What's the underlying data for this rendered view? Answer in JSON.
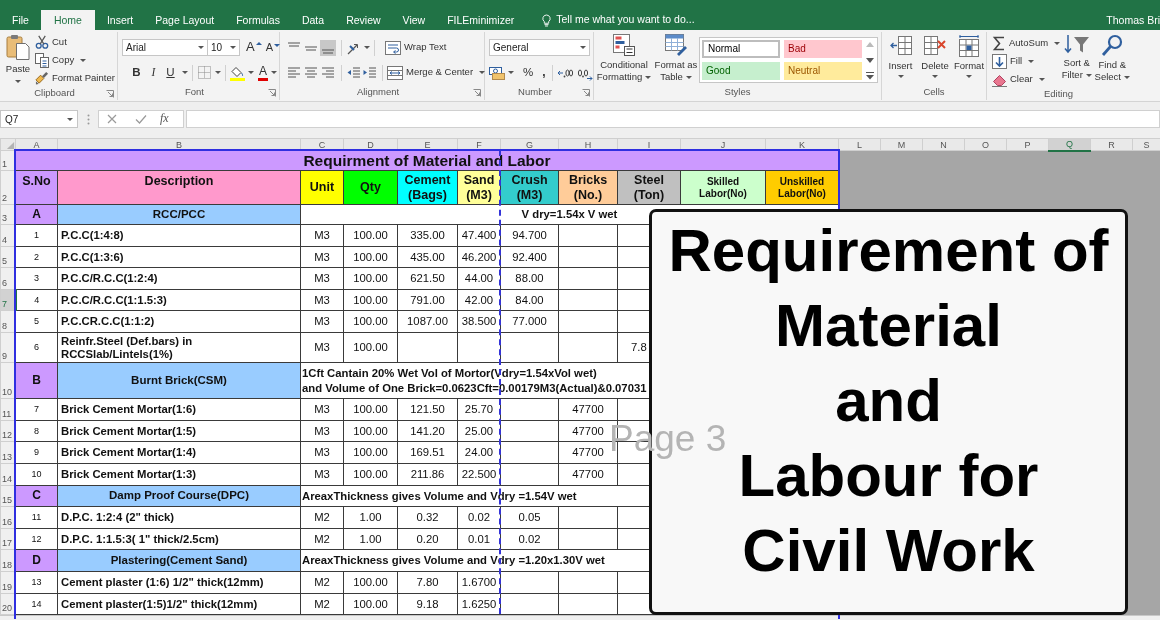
{
  "app": {
    "tell_me": "Tell me what you want to do...",
    "user_name": "Thomas Bri"
  },
  "ribbon_tabs": [
    {
      "label": "File",
      "selected": false
    },
    {
      "label": "Home",
      "selected": true
    },
    {
      "label": "Insert",
      "selected": false
    },
    {
      "label": "Page Layout",
      "selected": false
    },
    {
      "label": "Formulas",
      "selected": false
    },
    {
      "label": "Data",
      "selected": false
    },
    {
      "label": "Review",
      "selected": false
    },
    {
      "label": "View",
      "selected": false
    },
    {
      "label": "FILEminimizer",
      "selected": false
    }
  ],
  "ribbon": {
    "clipboard": {
      "label": "Clipboard",
      "paste": "Paste",
      "cut": "Cut",
      "copy": "Copy",
      "format_painter": "Format Painter"
    },
    "font": {
      "label": "Font",
      "font_name": "Arial",
      "font_size": "10",
      "grow": "A",
      "shrink": "A",
      "bold": "B",
      "italic": "I",
      "underline": "U",
      "font_color": "A"
    },
    "alignment": {
      "label": "Alignment",
      "vertical": [
        {
          "kind": "top",
          "selected": false
        },
        {
          "kind": "middle",
          "selected": false
        },
        {
          "kind": "bottom",
          "selected": true
        }
      ],
      "wrap_text": "Wrap Text",
      "merge_center": "Merge & Center"
    },
    "number": {
      "label": "Number",
      "format": "General",
      "percent": "%",
      "comma": ","
    },
    "styles": {
      "label": "Styles",
      "conditional_formatting": "Conditional Formatting",
      "format_as_table": "Format as Table",
      "gallery": [
        {
          "label": "Normal",
          "kind": "normal"
        },
        {
          "label": "Bad",
          "kind": "bad"
        },
        {
          "label": "Good",
          "kind": "good"
        },
        {
          "label": "Neutral",
          "kind": "neutral"
        }
      ]
    },
    "cells": {
      "label": "Cells",
      "buttons": [
        {
          "label": "Insert",
          "kind": "insert"
        },
        {
          "label": "Delete",
          "kind": "delete"
        },
        {
          "label": "Format",
          "kind": "format"
        }
      ]
    },
    "editing": {
      "label": "Editing",
      "autosum": "AutoSum",
      "fill": "Fill",
      "clear": "Clear",
      "sort_filter": "Sort & Filter",
      "find_select": "Find & Select"
    }
  },
  "formula_bar": {
    "name_box": "Q7",
    "function_button": "fx"
  },
  "sheet": {
    "columns": [
      {
        "label": "A",
        "selected": false
      },
      {
        "label": "B",
        "selected": false
      },
      {
        "label": "C",
        "selected": false
      },
      {
        "label": "D",
        "selected": false
      },
      {
        "label": "E",
        "selected": false
      },
      {
        "label": "F",
        "selected": false
      },
      {
        "label": "G",
        "selected": false
      },
      {
        "label": "H",
        "selected": false
      },
      {
        "label": "I",
        "selected": false
      },
      {
        "label": "J",
        "selected": false
      },
      {
        "label": "K",
        "selected": false
      },
      {
        "label": "L",
        "selected": false
      },
      {
        "label": "M",
        "selected": false
      },
      {
        "label": "N",
        "selected": false
      },
      {
        "label": "O",
        "selected": false
      },
      {
        "label": "P",
        "selected": false
      },
      {
        "label": "Q",
        "selected": true
      },
      {
        "label": "R",
        "selected": false
      },
      {
        "label": "S",
        "selected": false
      }
    ],
    "rows": [
      {
        "number": "1",
        "selected": false,
        "kind": "title",
        "text": "Requirment of Material and Labor"
      },
      {
        "number": "2",
        "selected": false,
        "kind": "header",
        "cells": [
          {
            "text": "S.No",
            "color": "#cc99ff"
          },
          {
            "text": "Description",
            "color": "#ff99cc"
          },
          {
            "text": "Unit",
            "color": "#ffff00"
          },
          {
            "text": "Qty",
            "color": "#00ff00"
          },
          {
            "text": "Cement (Bags)",
            "color": "#00ffff"
          },
          {
            "text": "Sand (M3)",
            "color": "#ffff99"
          },
          {
            "text": "Crush (M3)",
            "color": "#33cccc"
          },
          {
            "text": "Bricks (No.)",
            "color": "#ffcc99"
          },
          {
            "text": "Steel (Ton)",
            "color": "#c0c0c0"
          },
          {
            "text": "Skilled Labor(No)",
            "color": "#ccffcc"
          },
          {
            "text": "Unskilled Labor(No)",
            "color": "#ffcc00"
          }
        ]
      },
      {
        "number": "3",
        "selected": false,
        "kind": "section",
        "code": "A",
        "title": "RCC/PCC",
        "note": {
          "kind": "centered",
          "text": "V dry=1.54x V wet"
        }
      },
      {
        "number": "4",
        "selected": false,
        "kind": "item",
        "sno": "1",
        "description": "P.C.C(1:4:8)",
        "unit": "M3",
        "qty": "100.00",
        "cement": "335.00",
        "sand": "47.400",
        "crush": "94.700"
      },
      {
        "number": "5",
        "selected": false,
        "kind": "item",
        "sno": "2",
        "description": "P.C.C(1:3:6)",
        "unit": "M3",
        "qty": "100.00",
        "cement": "435.00",
        "sand": "46.200",
        "crush": "92.400"
      },
      {
        "number": "6",
        "selected": false,
        "kind": "item",
        "sno": "3",
        "description": "P.C.C/R.C.C(1:2:4)",
        "unit": "M3",
        "qty": "100.00",
        "cement": "621.50",
        "sand": "44.00",
        "crush": "88.00"
      },
      {
        "number": "7",
        "selected": true,
        "kind": "item",
        "sno": "4",
        "description": "P.C.C/R.C.C(1:1.5:3)",
        "unit": "M3",
        "qty": "100.00",
        "cement": "791.00",
        "sand": "42.00",
        "crush": "84.00"
      },
      {
        "number": "8",
        "selected": false,
        "kind": "item",
        "sno": "5",
        "description": "P.C.CR.C.C(1:1:2)",
        "unit": "M3",
        "qty": "100.00",
        "cement": "1087.00",
        "sand": "38.500",
        "crush": "77.000"
      },
      {
        "number": "9",
        "selected": false,
        "kind": "item",
        "sno": "6",
        "description": "Reinfr.Steel (Def.bars) in RCCSlab/Lintels(1%)",
        "unit": "M3",
        "qty": "100.00",
        "steel": "7.8"
      },
      {
        "number": "10",
        "selected": false,
        "kind": "section",
        "code": "B",
        "title": "Burnt Brick(CSM)",
        "note": {
          "kind": "plain",
          "text": "1Cft Cantain 20% Wet Vol of Mortor(Vdry=1.54xVol wet)\nand Volume of One Brick=0.0623Cft=0.00179M3(Actual)&0.07031"
        }
      },
      {
        "number": "11",
        "selected": false,
        "kind": "item",
        "sno": "7",
        "description": "Brick Cement Mortar(1:6)",
        "unit": "M3",
        "qty": "100.00",
        "cement": "121.50",
        "sand": "25.70",
        "bricks": "47700"
      },
      {
        "number": "12",
        "selected": false,
        "kind": "item",
        "sno": "8",
        "description": "Brick Cement Mortar(1:5)",
        "unit": "M3",
        "qty": "100.00",
        "cement": "141.20",
        "sand": "25.00",
        "bricks": "47700"
      },
      {
        "number": "13",
        "selected": false,
        "kind": "item",
        "sno": "9",
        "description": "Brick Cement Mortar(1:4)",
        "unit": "M3",
        "qty": "100.00",
        "cement": "169.51",
        "sand": "24.00",
        "bricks": "47700"
      },
      {
        "number": "14",
        "selected": false,
        "kind": "item",
        "sno": "10",
        "description": "Brick Cement Mortar(1:3)",
        "unit": "M3",
        "qty": "100.00",
        "cement": "211.86",
        "sand": "22.500",
        "bricks": "47700"
      },
      {
        "number": "15",
        "selected": false,
        "kind": "section",
        "code": "C",
        "title": "Damp Proof Course(DPC)",
        "note": {
          "kind": "plain",
          "text": "AreaxThickness gives Volume and Vdry =1.54V wet"
        }
      },
      {
        "number": "16",
        "selected": false,
        "kind": "item",
        "sno": "11",
        "description": "D.P.C. 1:2:4 (2\" thick)",
        "unit": "M2",
        "qty": "1.00",
        "cement": "0.32",
        "sand": "0.02",
        "crush": "0.05"
      },
      {
        "number": "17",
        "selected": false,
        "kind": "item",
        "sno": "12",
        "description": "D.P.C. 1:1.5:3( 1\" thick/2.5cm)",
        "unit": "M2",
        "qty": "1.00",
        "cement": "0.20",
        "sand": "0.01",
        "crush": "0.02"
      },
      {
        "number": "18",
        "selected": false,
        "kind": "section",
        "code": "D",
        "title": "Plastering(Cement Sand)",
        "note": {
          "kind": "plain",
          "text": "AreaxThickness gives Volume and Vdry =1.20x1.30V wet"
        }
      },
      {
        "number": "19",
        "selected": false,
        "kind": "item",
        "sno": "13",
        "description": "Cement plaster (1:6) 1/2\" thick(12mm)",
        "unit": "M2",
        "qty": "100.00",
        "cement": "7.80",
        "sand": "1.6700"
      },
      {
        "number": "20",
        "selected": false,
        "kind": "item",
        "sno": "14",
        "description": "Cement plaster(1:5)1/2\" thick(12mm)",
        "unit": "M2",
        "qty": "100.00",
        "cement": "9.18",
        "sand": "1.6250"
      }
    ],
    "page_labels": [
      "Page 3"
    ]
  },
  "overlay": {
    "title": "Requirement of\nMaterial\nand\nLabour for\nCivil Work"
  }
}
